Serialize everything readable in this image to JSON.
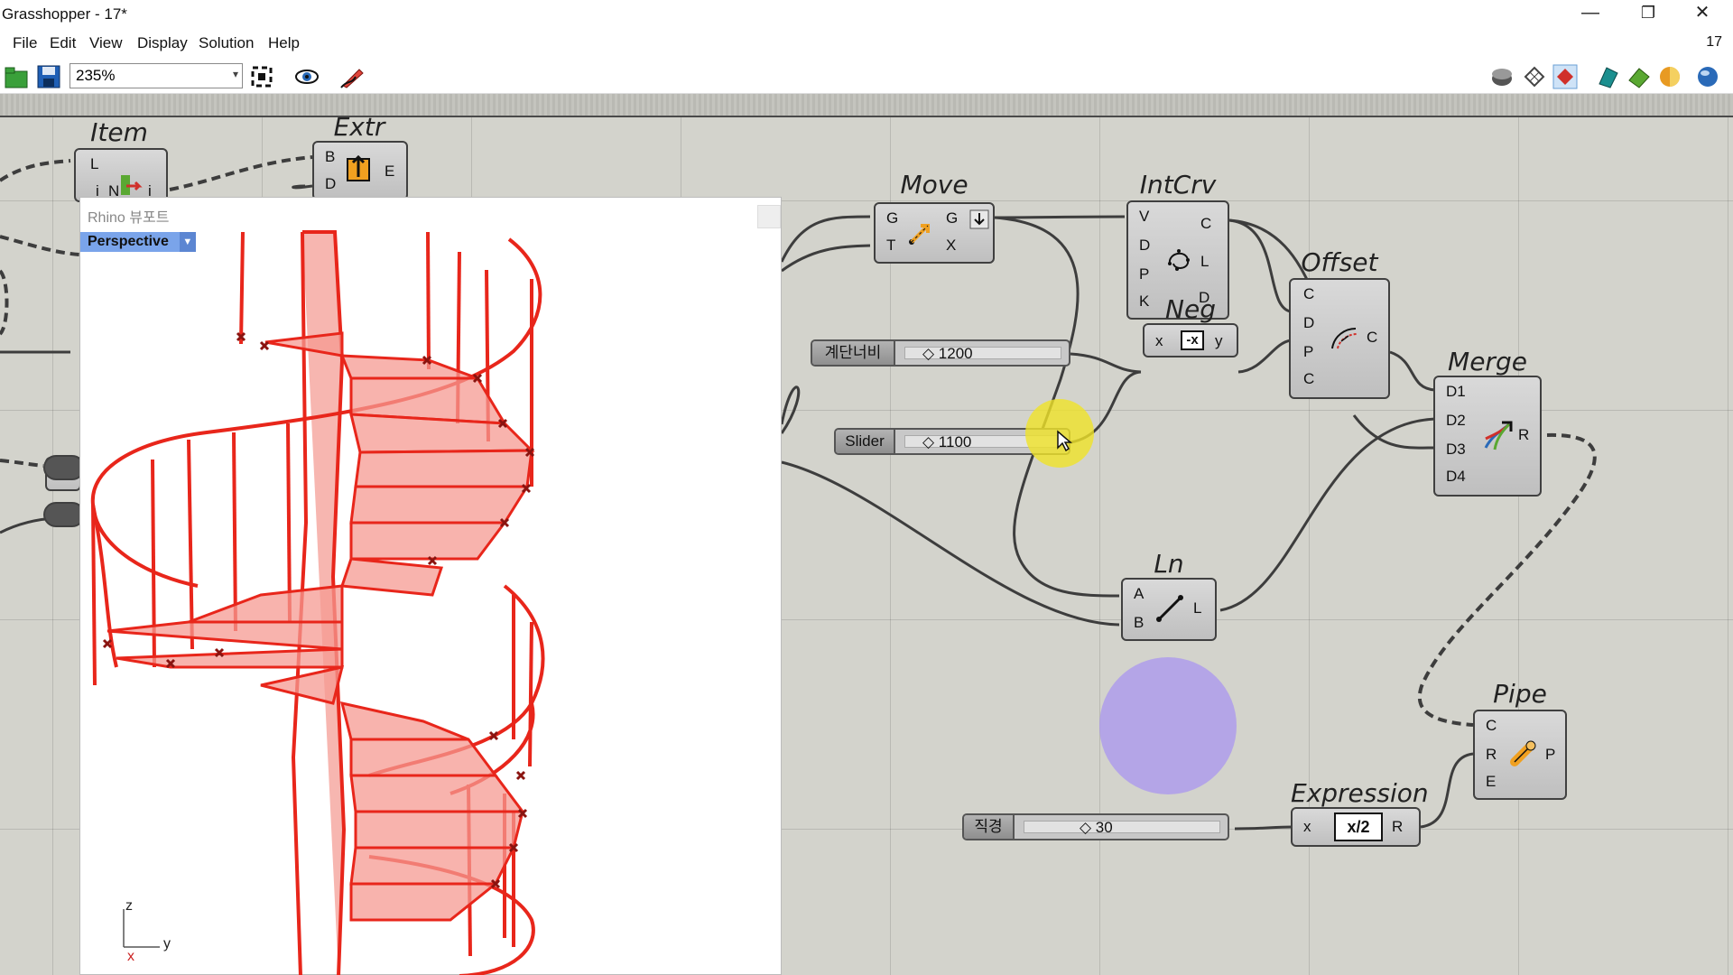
{
  "window": {
    "title": "Grasshopper - 17*",
    "minimize": "—",
    "restore": "❐",
    "close": "✕"
  },
  "menu": {
    "items": [
      "File",
      "Edit",
      "View",
      "Display",
      "Solution",
      "Help"
    ],
    "doc_number": "17"
  },
  "toolbar": {
    "zoom": "235%"
  },
  "viewport": {
    "title": "Rhino 뷰포트",
    "view_name": "Perspective",
    "axis": {
      "z": "z",
      "y": "y",
      "x": "x"
    }
  },
  "components": {
    "item": {
      "title": "Item",
      "inputs": [
        "L",
        "i"
      ],
      "output_prefix": "N",
      "output": "i"
    },
    "extr": {
      "title": "Extr",
      "inputs": [
        "B",
        "D"
      ],
      "output": "E"
    },
    "move": {
      "title": "Move",
      "inputs": [
        "G",
        "T"
      ],
      "outputs": [
        "G",
        "X"
      ]
    },
    "intcrv": {
      "title": "IntCrv",
      "inputs": [
        "V",
        "D",
        "P",
        "K"
      ],
      "outputs": [
        "C",
        "L",
        "D"
      ]
    },
    "offset": {
      "title": "Offset",
      "inputs": [
        "C",
        "D",
        "P",
        "C"
      ],
      "output": "C"
    },
    "neg": {
      "title": "Neg",
      "input": "x",
      "output": "y",
      "icon": "-x"
    },
    "merge": {
      "title": "Merge",
      "inputs": [
        "D1",
        "D2",
        "D3",
        "D4"
      ],
      "output": "R"
    },
    "ln": {
      "title": "Ln",
      "inputs": [
        "A",
        "B"
      ],
      "output": "L"
    },
    "pipe": {
      "title": "Pipe",
      "inputs": [
        "C",
        "R",
        "E"
      ],
      "output": "P"
    },
    "expression": {
      "title": "Expression",
      "input": "x",
      "formula": "x/2",
      "output": "R"
    }
  },
  "sliders": {
    "width": {
      "label": "계단너비",
      "value": "◇ 1200"
    },
    "slider": {
      "label": "Slider",
      "value": "◇ 1100"
    },
    "diameter": {
      "label": "직경",
      "value": "◇ 30"
    }
  },
  "colors": {
    "canvas": "#d3d3cc",
    "geometry": "#e8261b",
    "geometry_fill": "#f59a92",
    "ln_highlight": "#a996f0",
    "cursor_highlight": "#f0e428"
  }
}
